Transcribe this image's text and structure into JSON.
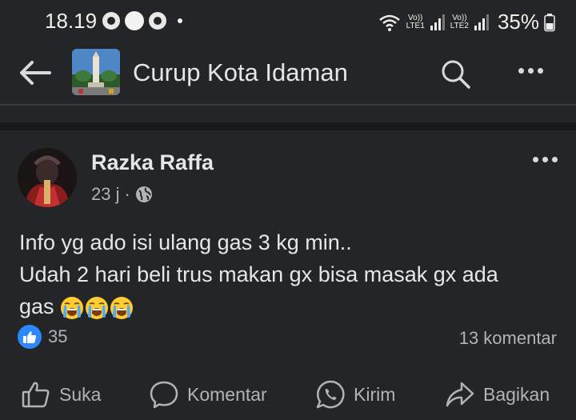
{
  "status_bar": {
    "time": "18.19",
    "sim1": "LTE1",
    "sim2": "LTE2",
    "volte": "Vo))",
    "battery": "35%"
  },
  "app_bar": {
    "group_name": "Curup Kota Idaman"
  },
  "post": {
    "author": "Razka Raffa",
    "time_ago": "23 j",
    "separator": "·",
    "text_line1": "Info yg ado isi ulang gas 3 kg min..",
    "text_line2": "Udah 2 hari beli trus makan gx bisa masak gx ada",
    "text_line3": "gas",
    "emoji": [
      "loudly-crying-face",
      "loudly-crying-face",
      "loudly-crying-face"
    ],
    "reaction_count": "35",
    "comment_count": "13 komentar"
  },
  "actions": {
    "like": "Suka",
    "comment": "Komentar",
    "send": "Kirim",
    "share": "Bagikan"
  },
  "colors": {
    "background": "#242526",
    "separator": "#18191a",
    "text_primary": "#e4e6eb",
    "text_secondary": "#b0b3b8",
    "like_blue": "#2d88ff"
  }
}
